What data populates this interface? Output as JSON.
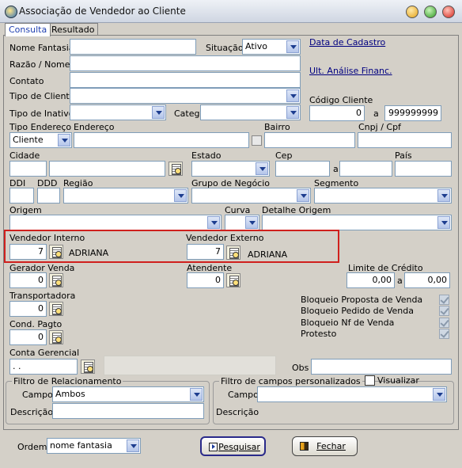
{
  "window": {
    "title": "Associação de Vendedor ao Cliente"
  },
  "tabs": [
    "Consulta",
    "Resultado"
  ],
  "form": {
    "nome_fantasia": {
      "label": "Nome Fantasia",
      "value": ""
    },
    "situacao": {
      "label": "Situação",
      "value": "Ativo"
    },
    "data_cadastro": "Data de Cadastro",
    "razao_nome": {
      "label": "Razão / Nome",
      "value": ""
    },
    "ult_analise": "Ult. Análise Financ.",
    "contato": {
      "label": "Contato",
      "value": ""
    },
    "tipo_cliente": {
      "label": "Tipo de Cliente",
      "value": ""
    },
    "codigo_cliente": {
      "label": "Código Cliente",
      "from": "0",
      "sep": "a",
      "to": "999999999"
    },
    "tipo_inativo": {
      "label": "Tipo de Inativo",
      "value": ""
    },
    "categ": {
      "label": "Categ.",
      "value": ""
    },
    "tipo_endereco": {
      "label": "Tipo Endereço",
      "value": "Cliente"
    },
    "endereco": {
      "label": "Endereço",
      "value": ""
    },
    "bairro": {
      "label": "Bairro",
      "value": ""
    },
    "cnpj_cpf": {
      "label": "Cnpj / Cpf",
      "value": ""
    },
    "cidade": {
      "label": "Cidade"
    },
    "estado": {
      "label": "Estado"
    },
    "cep": {
      "label": "Cep",
      "sep": "a"
    },
    "pais": {
      "label": "País"
    },
    "ddi": {
      "label": "DDI"
    },
    "ddd": {
      "label": "DDD"
    },
    "regiao": {
      "label": "Região"
    },
    "grupo_negocio": {
      "label": "Grupo de Negócio"
    },
    "segmento": {
      "label": "Segmento"
    },
    "origem": {
      "label": "Origem"
    },
    "curva": {
      "label": "Curva"
    },
    "detalhe_origem": {
      "label": "Detalhe Origem"
    },
    "vendedor_interno": {
      "label": "Vendedor Interno",
      "code": "7",
      "name": "ADRIANA"
    },
    "vendedor_externo": {
      "label": "Vendedor Externo",
      "code": "7",
      "name": "ADRIANA"
    },
    "gerador_venda": {
      "label": "Gerador Venda",
      "value": "0"
    },
    "atendente": {
      "label": "Atendente",
      "value": "0"
    },
    "limite_credito": {
      "label": "Limite de Crédito",
      "from": "0,00",
      "sep": "a",
      "to": "0,00"
    },
    "transportadora": {
      "label": "Transportadora",
      "value": "0"
    },
    "cond_pagto": {
      "label": "Cond. Pagto",
      "value": "0"
    },
    "conta_gerencial": {
      "label": "Conta Gerencial",
      "value": ". ."
    },
    "obs": {
      "label": "Obs"
    },
    "bloqueios": [
      "Bloqueio Proposta de Venda",
      "Bloqueio Pedido de Venda",
      "Bloqueio Nf de Venda",
      "Protesto"
    ]
  },
  "filtro_relacionamento": {
    "title": "Filtro de Relacionamento",
    "campo_label": "Campo",
    "campo_value": "Ambos",
    "descricao_label": "Descrição"
  },
  "filtro_personalizado": {
    "title": "Filtro de campos personalizados",
    "visualizar": "Visualizar",
    "campo_label": "Campo",
    "descricao_label": "Descrição"
  },
  "footer": {
    "ordem_label": "Ordem",
    "ordem_value": "nome fantasia",
    "pesquisar": "Pesquisar",
    "fechar": "Fechar"
  }
}
